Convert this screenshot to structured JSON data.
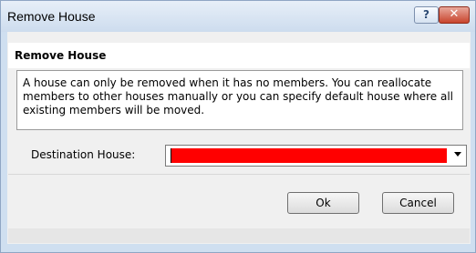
{
  "window": {
    "title": "Remove House",
    "help_button": "?",
    "close_button": "✕"
  },
  "header": {
    "title": "Remove House"
  },
  "info": {
    "text": "A house can only be removed when it has no members. You can reallocate members to other houses manually or you can specify default house where all existing members will be moved."
  },
  "destination": {
    "label": "Destination House:",
    "value": "",
    "value_highlight_color": "#ff0000",
    "dropdown_icon": "chevron-down-icon"
  },
  "buttons": {
    "ok": "Ok",
    "cancel": "Cancel"
  }
}
